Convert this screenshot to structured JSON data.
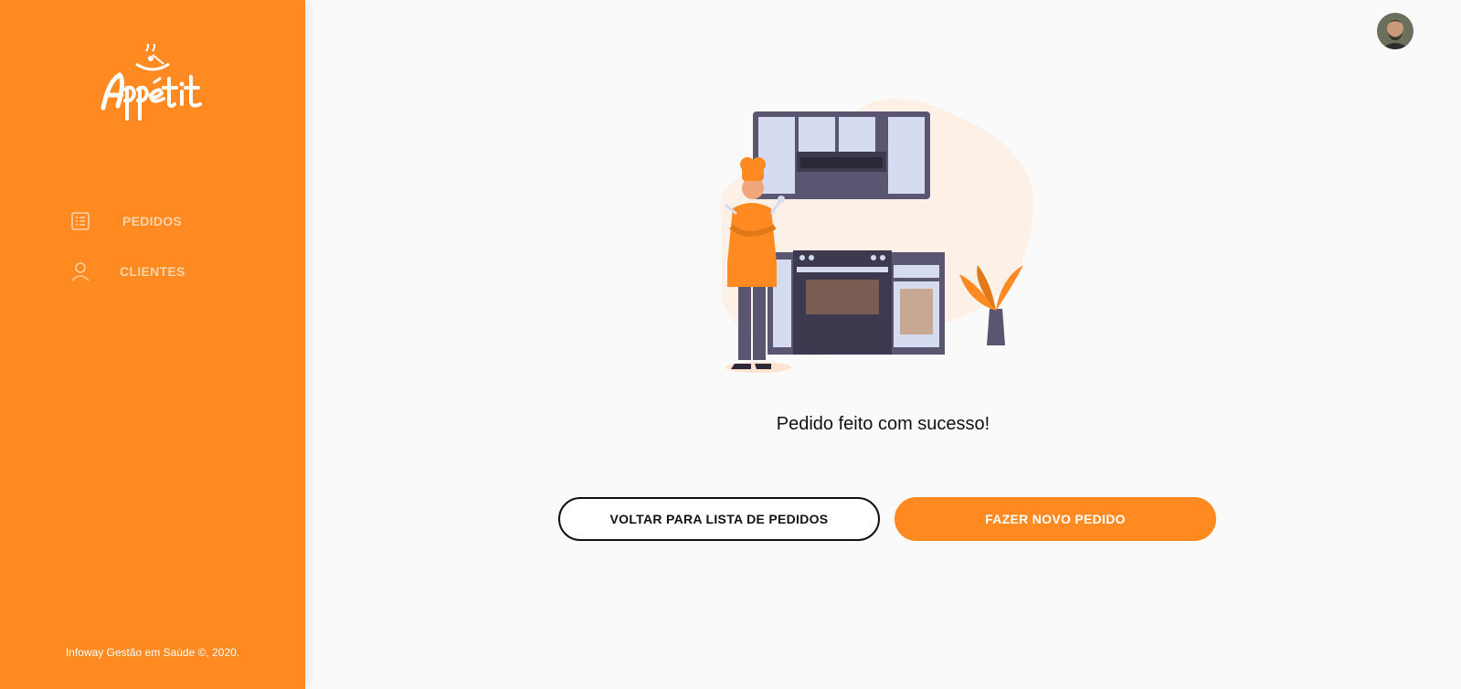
{
  "brand": {
    "name": "Appetit",
    "accent_color": "#ff8a21"
  },
  "sidebar": {
    "items": [
      {
        "label": "PEDIDOS",
        "icon": "order-list-icon"
      },
      {
        "label": "CLIENTES",
        "icon": "user-icon"
      }
    ],
    "footer": "Infoway Gestão em Saúde ©, 2020."
  },
  "header": {
    "avatar": "user-avatar"
  },
  "main": {
    "illustration": "chef-kitchen-illustration",
    "message": "Pedido feito com sucesso!",
    "back_button_label": "VOLTAR PARA LISTA DE PEDIDOS",
    "new_order_button_label": "FAZER NOVO PEDIDO"
  }
}
